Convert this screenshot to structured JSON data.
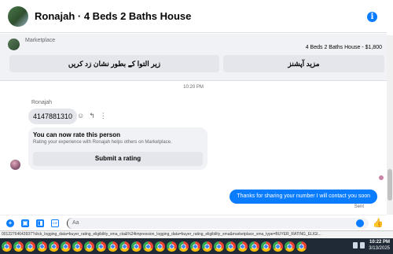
{
  "header": {
    "title": "Ronajah · 4 Beds 2 Baths House",
    "info_icon": "info-icon",
    "info_glyph": "i"
  },
  "marketplace": {
    "label": "Marketplace",
    "listing": "4 Beds 2 Baths House - $1,800",
    "left_button": "زیر التوا کے بطور نشان زد کریں",
    "right_button": "مزید آپشنز"
  },
  "chat": {
    "timestamp": "10:20 PM",
    "sender": "Ronajah",
    "received_message": "4147881310",
    "action_icons": [
      "emoji-icon",
      "reply-icon",
      "more-icon"
    ],
    "action_glyphs": [
      "☺",
      "↰",
      "⋮"
    ],
    "rate_card": {
      "heading": "You can now rate this person",
      "subtext": "Rating your experience with Ronajah helps others on Marketplace.",
      "button": "Submit a rating"
    },
    "sent_message": "Thanks for sharing your number I will contact you soon",
    "sent_status": "Sent"
  },
  "composer": {
    "placeholder": "Aa",
    "icons": [
      "plus-icon",
      "image-icon",
      "sticker-icon",
      "gif-icon"
    ],
    "glyphs": [
      "+",
      "▣",
      "◨",
      "GIF"
    ],
    "like_glyph": "👍"
  },
  "status_url": "00122764643937?click_logging_data=buyer_rating_eligibility_xma_cta&%24impression_logging_data=buyer_rating_eligibility_xma&marketplace_xma_type=BUYER_RATING_ELIGI...",
  "taskbar": {
    "time": "10:22 PM",
    "date": "3/13/2025",
    "app_count": 26
  },
  "colors": {
    "accent": "#0a7cff",
    "bubble_grey": "#e4e6eb",
    "taskbar": "#1f2a36"
  }
}
